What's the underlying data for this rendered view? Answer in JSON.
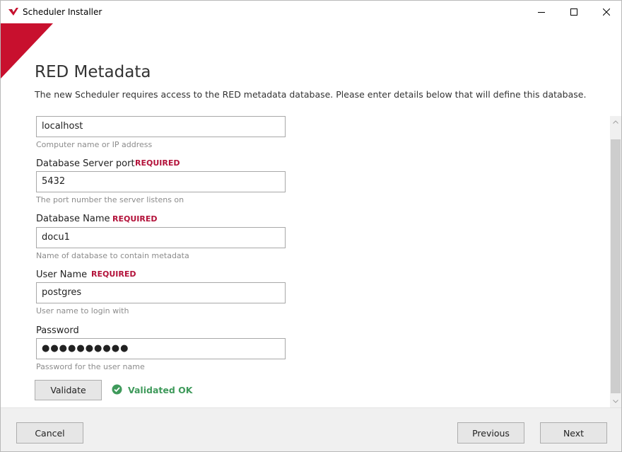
{
  "window": {
    "title": "Scheduler Installer",
    "controls": {
      "minimize": "minimize-icon",
      "maximize": "maximize-icon",
      "close": "close-icon"
    },
    "accent_color": "#c8102e"
  },
  "page": {
    "heading": "RED Metadata",
    "description": "The new Scheduler requires access to the RED metadata database. Please enter details below that will define this database."
  },
  "form": {
    "required_label": "REQUIRED",
    "fields": [
      {
        "label": "",
        "value": "localhost",
        "hint": "Computer name or IP address",
        "required": false
      },
      {
        "label": "Database Server port",
        "value": "5432",
        "hint": "The port number the server listens on",
        "required": true
      },
      {
        "label": "Database Name",
        "value": "docu1",
        "hint": "Name of database to contain metadata",
        "required": true
      },
      {
        "label": "User Name",
        "value": "postgres",
        "hint": "User name to login with",
        "required": true
      },
      {
        "label": "Password",
        "value": "●●●●●●●●●●",
        "hint": "Password for the user name",
        "required": false
      }
    ]
  },
  "validate": {
    "button_label": "Validate",
    "status_text": "Validated OK",
    "status_color": "#3f9a5b"
  },
  "footer": {
    "cancel_label": "Cancel",
    "previous_label": "Previous",
    "next_label": "Next"
  }
}
